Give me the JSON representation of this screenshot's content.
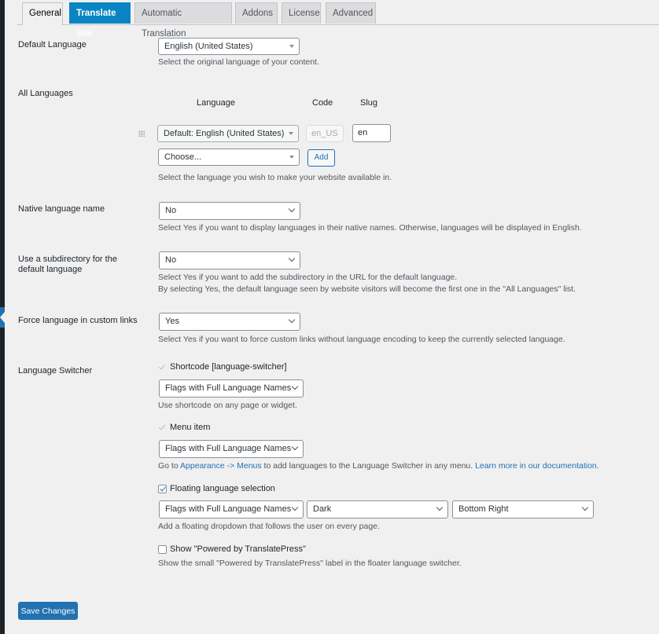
{
  "tabs": [
    {
      "label": "General",
      "active": true
    },
    {
      "label": "Translate Site",
      "highlight": true
    },
    {
      "label": "Automatic Translation"
    },
    {
      "label": "Addons"
    },
    {
      "label": "License"
    },
    {
      "label": "Advanced"
    }
  ],
  "default_language": {
    "label": "Default Language",
    "value": "English (United States)",
    "description": "Select the original language of your content."
  },
  "all_languages": {
    "label": "All Languages",
    "columns": {
      "language": "Language",
      "code": "Code",
      "slug": "Slug"
    },
    "rows": [
      {
        "language": "Default: English (United States)",
        "code": "en_US",
        "slug": "en"
      }
    ],
    "choose_placeholder": "Choose...",
    "add_label": "Add",
    "description": "Select the language you wish to make your website available in."
  },
  "native_name": {
    "label": "Native language name",
    "value": "No",
    "description": "Select Yes if you want to display languages in their native names. Otherwise, languages will be displayed in English."
  },
  "subdirectory": {
    "label_line1": "Use a subdirectory for the",
    "label_line2": "default language",
    "value": "No",
    "description_line1": "Select Yes if you want to add the subdirectory in the URL for the default language.",
    "description_line2": "By selecting Yes, the default language seen by website visitors will become the first one in the \"All Languages\" list."
  },
  "force_language": {
    "label": "Force language in custom links",
    "value": "Yes",
    "description": "Select Yes if you want to force custom links without language encoding to keep the currently selected language."
  },
  "language_switcher": {
    "label": "Language Switcher",
    "shortcode": {
      "label": "Shortcode [language-switcher]",
      "checked": true,
      "value": "Flags with Full Language Names",
      "description": "Use shortcode on any page or widget."
    },
    "menu_item": {
      "label": "Menu item",
      "checked": true,
      "value": "Flags with Full Language Names",
      "desc_prefix": "Go to ",
      "desc_link1": "Appearance -> Menus",
      "desc_middle": " to add languages to the Language Switcher in any menu. ",
      "desc_link2": "Learn more in our documentation."
    },
    "floating": {
      "label": "Floating language selection",
      "checked": true,
      "value": "Flags with Full Language Names",
      "theme": "Dark",
      "position": "Bottom Right",
      "description": "Add a floating dropdown that follows the user on every page."
    },
    "powered_by": {
      "label": "Show \"Powered by TranslatePress\"",
      "checked": false,
      "description": "Show the small \"Powered by TranslatePress\" label in the floater language switcher."
    }
  },
  "save_label": "Save Changes",
  "colors": {
    "accent": "#2271b1",
    "highlight_tab": "#0a85c3",
    "background": "#f0f0f1",
    "admin_bar": "#1d2327"
  }
}
